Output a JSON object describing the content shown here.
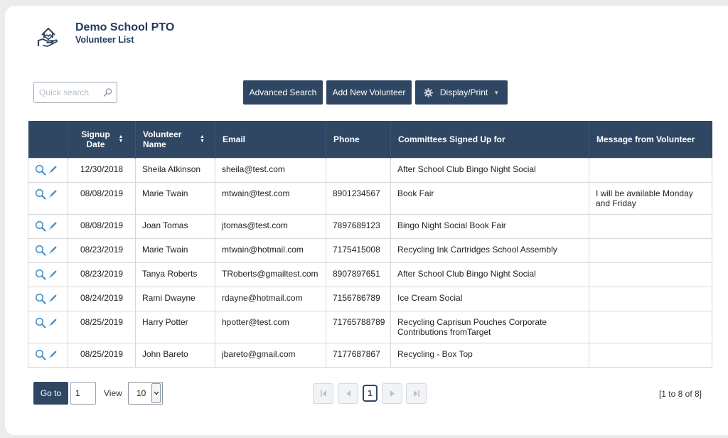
{
  "header": {
    "org_name": "Demo School PTO",
    "page_title": "Volunteer List"
  },
  "toolbar": {
    "search_placeholder": "Quick search",
    "advanced_search_label": "Advanced Search",
    "add_volunteer_label": "Add New Volunteer",
    "display_print_label": "Display/Print"
  },
  "table": {
    "columns": [
      {
        "label": "",
        "sortable": false
      },
      {
        "label": "Signup Date",
        "sortable": true
      },
      {
        "label": "Volunteer Name",
        "sortable": true
      },
      {
        "label": "Email",
        "sortable": false
      },
      {
        "label": "Phone",
        "sortable": false
      },
      {
        "label": "Committees Signed Up for",
        "sortable": false
      },
      {
        "label": "Message from Volunteer",
        "sortable": false
      }
    ],
    "rows": [
      {
        "date": "12/30/2018",
        "name": "Sheila Atkinson",
        "email": "sheila@test.com",
        "phone": "",
        "committees": "After School Club Bingo Night Social",
        "message": ""
      },
      {
        "date": "08/08/2019",
        "name": "Marie Twain",
        "email": "mtwain@test.com",
        "phone": "8901234567",
        "committees": "Book Fair",
        "message": "I will be available Monday and Friday"
      },
      {
        "date": "08/08/2019",
        "name": "Joan Tomas",
        "email": "jtomas@test.com",
        "phone": "7897689123",
        "committees": "Bingo Night Social Book Fair",
        "message": ""
      },
      {
        "date": "08/23/2019",
        "name": "Marie Twain",
        "email": "mtwain@hotmail.com",
        "phone": "7175415008",
        "committees": "Recycling Ink Cartridges School Assembly",
        "message": ""
      },
      {
        "date": "08/23/2019",
        "name": "Tanya Roberts",
        "email": "TRoberts@gmailtest.com",
        "phone": "8907897651",
        "committees": "After School Club Bingo Night Social",
        "message": ""
      },
      {
        "date": "08/24/2019",
        "name": "Rami Dwayne",
        "email": "rdayne@hotmail.com",
        "phone": "7156786789",
        "committees": "Ice Cream Social",
        "message": ""
      },
      {
        "date": "08/25/2019",
        "name": "Harry Potter",
        "email": "hpotter@test.com",
        "phone": "71765788789",
        "committees": "Recycling Caprisun Pouches Corporate Contributions fromTarget",
        "message": ""
      },
      {
        "date": "08/25/2019",
        "name": "John Bareto",
        "email": "jbareto@gmail.com",
        "phone": "7177687867",
        "committees": "Recycling - Box Top",
        "message": ""
      }
    ]
  },
  "pagination": {
    "goto_label": "Go to",
    "goto_value": "1",
    "view_label": "View",
    "page_size": "10",
    "current_page": "1",
    "range_text": "[1 to 8 of 8]"
  },
  "icons": {
    "brand": "hand-heart-house-icon",
    "search": "search-icon",
    "gear": "gear-icon",
    "view": "magnifier-icon",
    "edit": "pencil-icon",
    "first": "first-page-icon",
    "prev": "prev-page-icon",
    "next": "next-page-icon",
    "last": "last-page-icon"
  },
  "colors": {
    "primary": "#2f4762",
    "brand_text": "#1f3a5f",
    "action_icon": "#4a90c4"
  }
}
